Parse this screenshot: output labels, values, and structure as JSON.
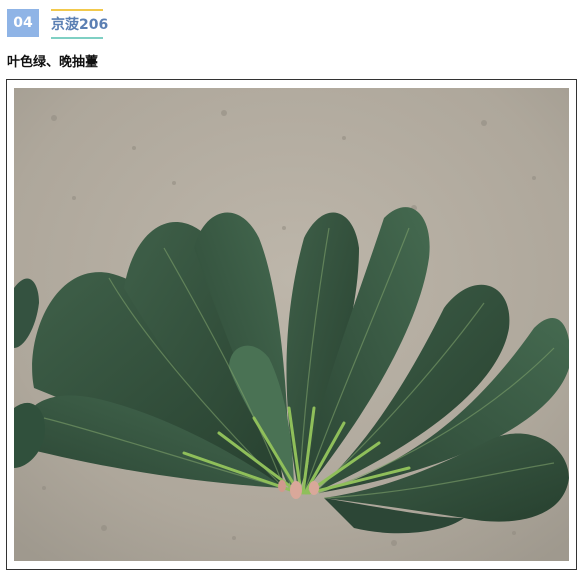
{
  "header": {
    "number": "04",
    "title": "京菠206"
  },
  "subtitle": "叶色绿、晚抽薹",
  "photo": {
    "subject": "spinach-leaves",
    "colors": {
      "ground": "#b3aca0",
      "leaf_dark": "#2f4a3a",
      "leaf_mid": "#3d5c47",
      "stem": "#8fbf5a"
    }
  }
}
